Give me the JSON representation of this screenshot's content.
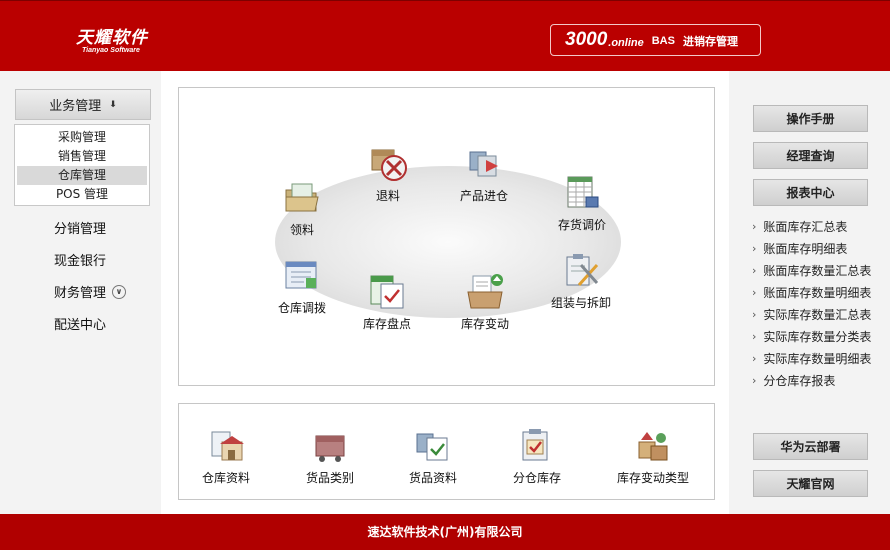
{
  "header": {
    "logo_cn": "天耀软件",
    "logo_en": "Tianyao Software",
    "product_num": "3000",
    "product_online": ".online",
    "product_bas": "BAS",
    "product_cn": "进销存管理"
  },
  "left": {
    "business_btn": "业务管理",
    "submenu": [
      "采购管理",
      "销售管理",
      "仓库管理",
      "POS 管理"
    ],
    "active_index": 2,
    "items": [
      "分销管理",
      "现金银行",
      "财务管理",
      "配送中心"
    ]
  },
  "main": {
    "tiles": {
      "tuiliao": "退料",
      "chanpin_jincang": "产品进仓",
      "lingliao": "领料",
      "cunhuo_tiaojia": "存货调价",
      "cangku_tiaobo": "仓库调拨",
      "zuzhuang": "组装与拆卸",
      "kucun_pandian": "库存盘点",
      "kucun_biandong": "库存变动"
    }
  },
  "bottom": {
    "tiles": [
      "仓库资料",
      "货品类别",
      "货品资料",
      "分仓库存",
      "库存变动类型"
    ]
  },
  "right": {
    "buttons": [
      "操作手册",
      "经理查询",
      "报表中心"
    ],
    "links": [
      "账面库存汇总表",
      "账面库存明细表",
      "账面库存数量汇总表",
      "账面库存数量明细表",
      "实际库存数量汇总表",
      "实际库存数量分类表",
      "实际库存数量明细表",
      "分仓库存报表"
    ],
    "bottom_buttons": [
      "华为云部署",
      "天耀官网"
    ]
  },
  "footer": {
    "text": "速达软件技术(广州)有限公司"
  },
  "colors": {
    "brand_red": "#ba0000",
    "footer_red": "#b00000"
  }
}
